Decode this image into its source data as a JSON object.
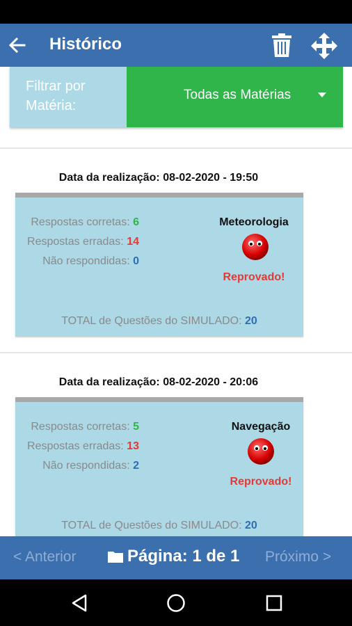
{
  "header": {
    "title": "Histórico",
    "back_icon": "arrow-left-icon",
    "trash_icon": "trash-icon",
    "move_icon": "move-arrows-icon"
  },
  "filter": {
    "label": "Filtrar por Matéria:",
    "selected": "Todas as Matérias"
  },
  "records": [
    {
      "date_label": "Data da realização: 08-02-2020 - 19:50",
      "correct_label": "Respostas corretas:",
      "correct": "6",
      "wrong_label": "Respostas erradas:",
      "wrong": "14",
      "unanswered_label": "Não respondidas:",
      "unanswered": "0",
      "subject": "Meteorologia",
      "result": "Reprovado!",
      "total_label": "TOTAL de Questões do SIMULADO:",
      "total": "20"
    },
    {
      "date_label": "Data da realização: 08-02-2020 - 20:06",
      "correct_label": "Respostas corretas:",
      "correct": "5",
      "wrong_label": "Respostas erradas:",
      "wrong": "13",
      "unanswered_label": "Não respondidas:",
      "unanswered": "2",
      "subject": "Navegação",
      "result": "Reprovado!",
      "total_label": "TOTAL de Questões do SIMULADO:",
      "total": "20"
    }
  ],
  "pager": {
    "prev": "< Anterior",
    "page": "Página: 1 de 1",
    "next": "Próximo >"
  },
  "colors": {
    "app_bar": "#3b6fae",
    "filter_select": "#2fb54a",
    "card": "#add8e6",
    "fail": "#e53935"
  }
}
